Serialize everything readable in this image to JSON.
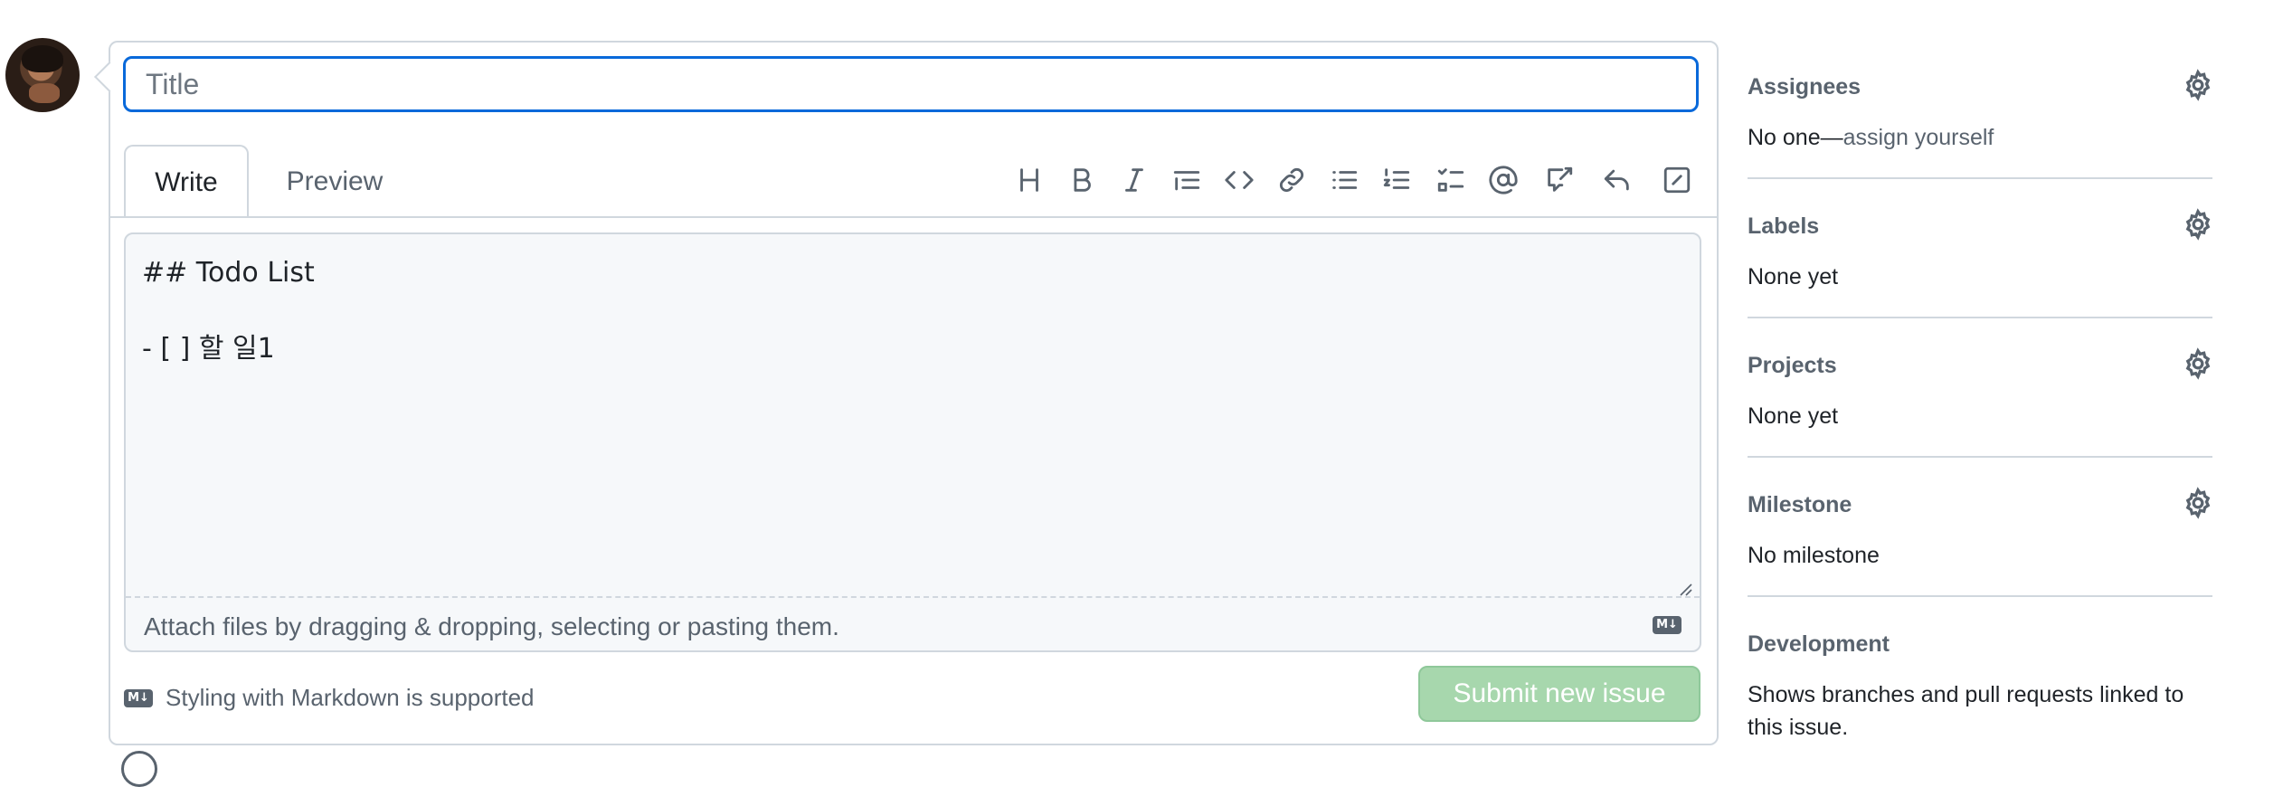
{
  "title_input": {
    "placeholder": "Title",
    "value": ""
  },
  "tabs": [
    {
      "label": "Write",
      "active": true
    },
    {
      "label": "Preview",
      "active": false
    }
  ],
  "toolbar": [
    {
      "icon": "heading-icon",
      "name": "heading"
    },
    {
      "icon": "bold-icon",
      "name": "bold"
    },
    {
      "icon": "italic-icon",
      "name": "italic"
    },
    {
      "icon": "quote-icon",
      "name": "quote"
    },
    {
      "icon": "code-icon",
      "name": "code"
    },
    {
      "icon": "link-icon",
      "name": "link"
    },
    {
      "icon": "unordered-list-icon",
      "name": "unordered-list"
    },
    {
      "icon": "ordered-list-icon",
      "name": "ordered-list"
    },
    {
      "icon": "task-list-icon",
      "name": "task-list"
    },
    {
      "icon": "mention-icon",
      "name": "mention"
    },
    {
      "icon": "reference-icon",
      "name": "reference"
    },
    {
      "icon": "saved-reply-icon",
      "name": "saved-reply"
    },
    {
      "icon": "fullscreen-icon",
      "name": "fullscreen"
    }
  ],
  "editor": {
    "content": "## Todo List\n\n- [ ] 할 일1",
    "attach_text": "Attach files by dragging & dropping, selecting or pasting them.",
    "md_badge": "M↓"
  },
  "footer": {
    "markdown_note": "Styling with Markdown is supported",
    "submit_label": "Submit new issue"
  },
  "sidebar": {
    "sections": [
      {
        "title": "Assignees",
        "value": "No one—",
        "link": "assign yourself"
      },
      {
        "title": "Labels",
        "value": "None yet"
      },
      {
        "title": "Projects",
        "value": "None yet"
      },
      {
        "title": "Milestone",
        "value": "No milestone"
      },
      {
        "title": "Development",
        "value": "Shows branches and pull requests linked to this issue."
      }
    ]
  },
  "colors": {
    "accent": "#0969da",
    "submit_disabled": "#a7d7ad",
    "muted_text": "#59636e",
    "border": "#d0d7de"
  }
}
